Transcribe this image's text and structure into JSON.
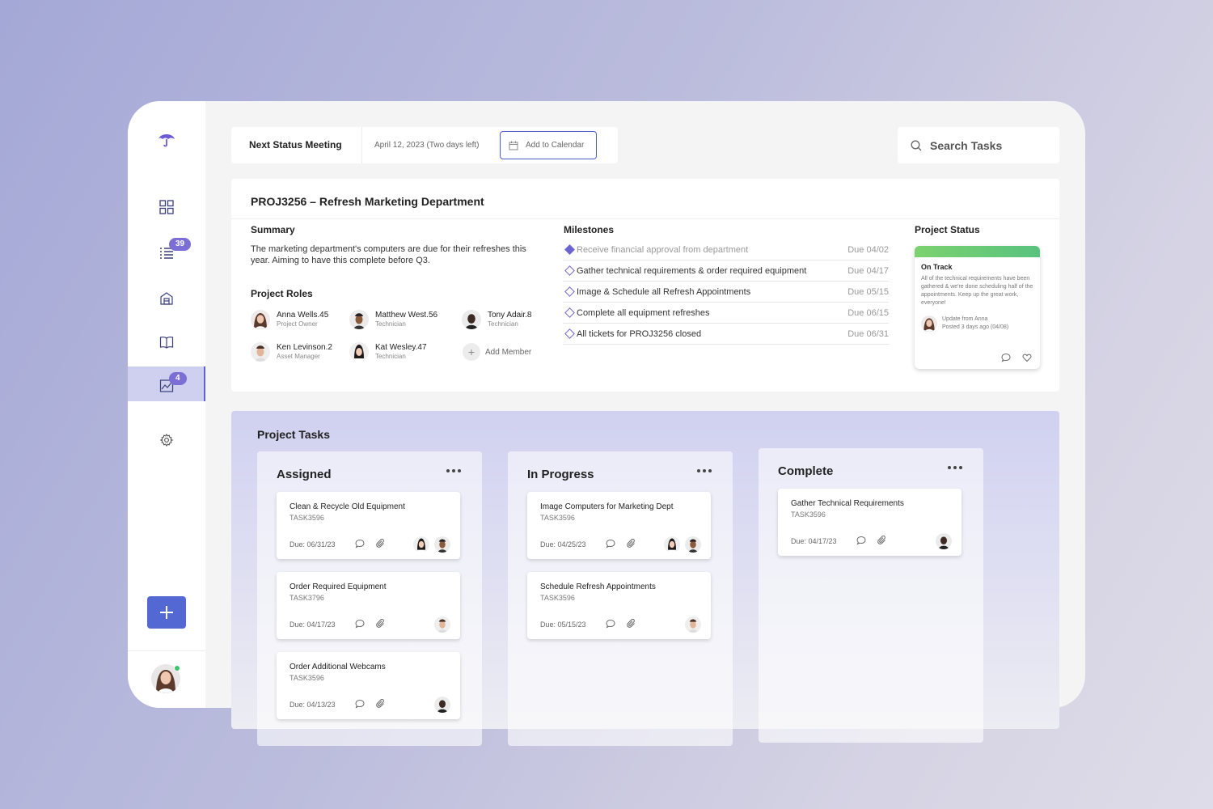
{
  "colors": {
    "accent": "#5468d4",
    "badge": "#7b6fd6",
    "status_on_track": "#6ccb76",
    "online": "#3bc46a"
  },
  "sidebar": {
    "items": [
      {
        "icon": "logo-icon"
      },
      {
        "icon": "dashboard-grid-icon"
      },
      {
        "icon": "task-list-icon",
        "badge": "39"
      },
      {
        "icon": "building-icon"
      },
      {
        "icon": "book-icon"
      },
      {
        "icon": "reports-chart-icon",
        "badge": "4",
        "active": true
      },
      {
        "icon": "settings-gear-icon"
      }
    ],
    "add_icon": "plus-icon",
    "user_avatar": "user-avatar"
  },
  "meeting": {
    "label": "Next Status Meeting",
    "date": "April 12, 2023 (Two days left)",
    "calendar_button": "Add to Calendar"
  },
  "search": {
    "placeholder": "Search Tasks"
  },
  "project": {
    "title": "PROJ3256 – Refresh Marketing Department",
    "summary_title": "Summary",
    "summary": "The marketing department's computers are due for their refreshes this year. Aiming to have this complete before Q3.",
    "roles_title": "Project Roles",
    "roles": [
      {
        "name": "Anna Wells.45",
        "role": "Project Owner"
      },
      {
        "name": "Matthew West.56",
        "role": "Technician"
      },
      {
        "name": "Tony Adair.8",
        "role": "Technician"
      },
      {
        "name": "Ken Levinson.2",
        "role": "Asset Manager"
      },
      {
        "name": "Kat Wesley.47",
        "role": "Technician"
      }
    ],
    "add_member": "Add Member",
    "milestones_title": "Milestones",
    "milestones": [
      {
        "text": "Receive financial approval from department",
        "due": "Due 04/02",
        "done": true
      },
      {
        "text": "Gather technical requirements & order required equipment",
        "due": "Due 04/17",
        "done": false
      },
      {
        "text": "Image & Schedule all Refresh Appointments",
        "due": "Due 05/15",
        "done": false
      },
      {
        "text": "Complete all equipment refreshes",
        "due": "Due 06/15",
        "done": false
      },
      {
        "text": "All tickets for PROJ3256 closed",
        "due": "Due 06/31",
        "done": false
      }
    ],
    "status_title": "Project Status",
    "status": {
      "label": "On Track",
      "text": "All of the technical requirements have been gathered & we're done scheduling half of the appointments. Keep up the great work, everyone!",
      "update_from": "Update from Anna",
      "posted": "Posted 3 days ago (04/08)"
    }
  },
  "tasks": {
    "title": "Project Tasks",
    "columns": [
      {
        "title": "Assigned",
        "cards": [
          {
            "name": "Clean & Recycle Old Equipment",
            "id": "TASK3596",
            "due": "Due: 06/31/23",
            "assignees": 2
          },
          {
            "name": "Order Required Equipment",
            "id": "TASK3796",
            "due": "Due: 04/17/23",
            "assignees": 1
          },
          {
            "name": "Order Additional Webcams",
            "id": "TASK3596",
            "due": "Due: 04/13/23",
            "assignees": 1
          }
        ]
      },
      {
        "title": "In Progress",
        "cards": [
          {
            "name": "Image Computers for Marketing Dept",
            "id": "TASK3596",
            "due": "Due: 04/25/23",
            "assignees": 2
          },
          {
            "name": "Schedule Refresh Appointments",
            "id": "TASK3596",
            "due": "Due: 05/15/23",
            "assignees": 1
          }
        ]
      },
      {
        "title": "Complete",
        "cards": [
          {
            "name": "Gather Technical Requirements",
            "id": "TASK3596",
            "due": "Due: 04/17/23",
            "assignees": 1
          }
        ]
      }
    ]
  }
}
